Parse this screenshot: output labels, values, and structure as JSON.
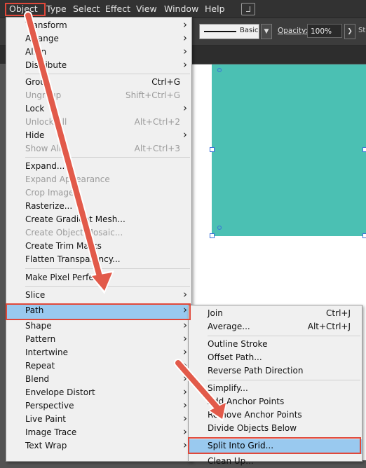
{
  "menubar": {
    "items": [
      "Object",
      "Type",
      "Select",
      "Effect",
      "View",
      "Window",
      "Help"
    ]
  },
  "control_bar": {
    "stroke_style": "Basic",
    "opacity_label": "Opacity:",
    "opacity_value": "100%",
    "cut_label": "St"
  },
  "object_menu": {
    "items": [
      {
        "label": "Transform",
        "shortcut": "",
        "submenu": true,
        "disabled": false
      },
      {
        "label": "Arrange",
        "shortcut": "",
        "submenu": true,
        "disabled": false
      },
      {
        "label": "Align",
        "shortcut": "",
        "submenu": true,
        "disabled": false
      },
      {
        "label": "Distribute",
        "shortcut": "",
        "submenu": true,
        "disabled": false
      },
      {
        "label": "Group",
        "shortcut": "Ctrl+G",
        "submenu": false,
        "disabled": false
      },
      {
        "label": "Ungroup",
        "shortcut": "Shift+Ctrl+G",
        "submenu": false,
        "disabled": true
      },
      {
        "label": "Lock",
        "shortcut": "",
        "submenu": true,
        "disabled": false
      },
      {
        "label": "Unlock All",
        "shortcut": "Alt+Ctrl+2",
        "submenu": false,
        "disabled": true
      },
      {
        "label": "Hide",
        "shortcut": "",
        "submenu": true,
        "disabled": false
      },
      {
        "label": "Show All",
        "shortcut": "Alt+Ctrl+3",
        "submenu": false,
        "disabled": true
      },
      {
        "label": "Expand...",
        "shortcut": "",
        "submenu": false,
        "disabled": false
      },
      {
        "label": "Expand Appearance",
        "shortcut": "",
        "submenu": false,
        "disabled": true
      },
      {
        "label": "Crop Image",
        "shortcut": "",
        "submenu": false,
        "disabled": true
      },
      {
        "label": "Rasterize...",
        "shortcut": "",
        "submenu": false,
        "disabled": false
      },
      {
        "label": "Create Gradient Mesh...",
        "shortcut": "",
        "submenu": false,
        "disabled": false
      },
      {
        "label": "Create Object Mosaic...",
        "shortcut": "",
        "submenu": false,
        "disabled": true
      },
      {
        "label": "Create Trim Marks",
        "shortcut": "",
        "submenu": false,
        "disabled": false
      },
      {
        "label": "Flatten Transparency...",
        "shortcut": "",
        "submenu": false,
        "disabled": false
      },
      {
        "label": "Make Pixel Perfect",
        "shortcut": "",
        "submenu": false,
        "disabled": false
      },
      {
        "label": "Slice",
        "shortcut": "",
        "submenu": true,
        "disabled": false
      },
      {
        "label": "Path",
        "shortcut": "",
        "submenu": true,
        "disabled": false
      },
      {
        "label": "Shape",
        "shortcut": "",
        "submenu": true,
        "disabled": false
      },
      {
        "label": "Pattern",
        "shortcut": "",
        "submenu": true,
        "disabled": false
      },
      {
        "label": "Intertwine",
        "shortcut": "",
        "submenu": true,
        "disabled": false
      },
      {
        "label": "Repeat",
        "shortcut": "",
        "submenu": true,
        "disabled": false
      },
      {
        "label": "Blend",
        "shortcut": "",
        "submenu": true,
        "disabled": false
      },
      {
        "label": "Envelope Distort",
        "shortcut": "",
        "submenu": true,
        "disabled": false
      },
      {
        "label": "Perspective",
        "shortcut": "",
        "submenu": true,
        "disabled": false
      },
      {
        "label": "Live Paint",
        "shortcut": "",
        "submenu": true,
        "disabled": false
      },
      {
        "label": "Image Trace",
        "shortcut": "",
        "submenu": true,
        "disabled": false
      },
      {
        "label": "Text Wrap",
        "shortcut": "",
        "submenu": true,
        "disabled": false
      }
    ]
  },
  "path_submenu": {
    "items": [
      {
        "label": "Join",
        "shortcut": "Ctrl+J"
      },
      {
        "label": "Average...",
        "shortcut": "Alt+Ctrl+J"
      },
      {
        "label": "Outline Stroke",
        "shortcut": ""
      },
      {
        "label": "Offset Path...",
        "shortcut": ""
      },
      {
        "label": "Reverse Path Direction",
        "shortcut": ""
      },
      {
        "label": "Simplify...",
        "shortcut": ""
      },
      {
        "label": "Add Anchor Points",
        "shortcut": ""
      },
      {
        "label": "Remove Anchor Points",
        "shortcut": ""
      },
      {
        "label": "Divide Objects Below",
        "shortcut": ""
      },
      {
        "label": "Split Into Grid...",
        "shortcut": ""
      },
      {
        "label": "Clean Up...",
        "shortcut": ""
      }
    ]
  },
  "colors": {
    "menu_highlight": "#99c9ef",
    "annotation_red": "#e0483a",
    "artwork_teal": "#4bc0b3"
  }
}
